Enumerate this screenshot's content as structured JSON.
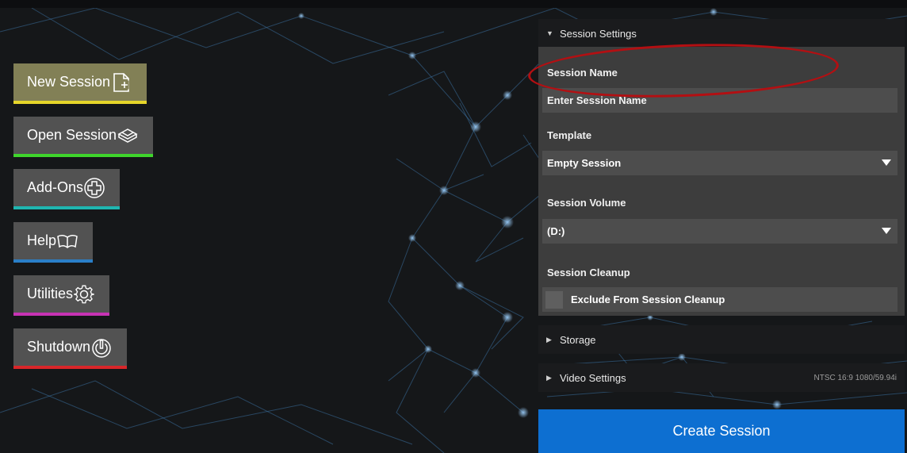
{
  "menu": {
    "items": [
      {
        "label": "New Session",
        "icon": "new-session-icon",
        "bar_color": "#e6d62a"
      },
      {
        "label": "Open Session",
        "icon": "open-session-icon",
        "bar_color": "#3fd52c"
      },
      {
        "label": "Add-Ons",
        "icon": "add-ons-icon",
        "bar_color": "#1fb6b1"
      },
      {
        "label": "Help",
        "icon": "help-book-icon",
        "bar_color": "#2a7fc7"
      },
      {
        "label": "Utilities",
        "icon": "gear-icon",
        "bar_color": "#c733b4"
      },
      {
        "label": "Shutdown",
        "icon": "power-icon",
        "bar_color": "#d9262a"
      }
    ]
  },
  "session_settings": {
    "header": "Session Settings",
    "session_name_label": "Session Name",
    "session_name_placeholder": "Enter Session Name",
    "template_label": "Template",
    "template_value": "Empty Session",
    "volume_label": "Session Volume",
    "volume_value": "(D:)",
    "cleanup_label": "Session Cleanup",
    "cleanup_checkbox_label": "Exclude From Session Cleanup"
  },
  "storage": {
    "header": "Storage"
  },
  "video_settings": {
    "header": "Video Settings",
    "summary": "NTSC 16:9 1080/59.94i"
  },
  "create_button": "Create Session",
  "colors": {
    "accent_blue": "#0d6fd1",
    "annotation_red": "#b30f12",
    "active_item": "#828056"
  }
}
